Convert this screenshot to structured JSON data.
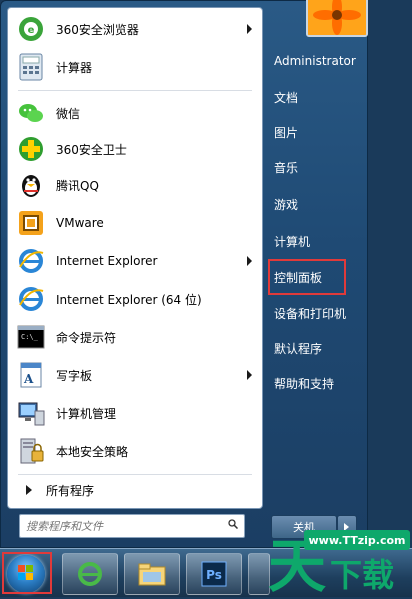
{
  "programs": [
    {
      "label": "360安全浏览器",
      "icon": "360-browser-icon",
      "submenu": true
    },
    {
      "label": "计算器",
      "icon": "calculator-icon",
      "submenu": false
    },
    {
      "label": "微信",
      "icon": "wechat-icon",
      "submenu": false
    },
    {
      "label": "360安全卫士",
      "icon": "360-safeguard-icon",
      "submenu": false
    },
    {
      "label": "腾讯QQ",
      "icon": "qq-penguin-icon",
      "submenu": false
    },
    {
      "label": "VMware",
      "icon": "vmware-icon",
      "submenu": false
    },
    {
      "label": "Internet Explorer",
      "icon": "internet-explorer-icon",
      "submenu": true
    },
    {
      "label": "Internet Explorer (64 位)",
      "icon": "internet-explorer-icon",
      "submenu": false
    },
    {
      "label": "命令提示符",
      "icon": "command-prompt-icon",
      "submenu": false
    },
    {
      "label": "写字板",
      "icon": "wordpad-icon",
      "submenu": true
    },
    {
      "label": "计算机管理",
      "icon": "computer-management-icon",
      "submenu": false
    },
    {
      "label": "本地安全策略",
      "icon": "local-security-policy-icon",
      "submenu": false
    }
  ],
  "all_programs_label": "所有程序",
  "search": {
    "placeholder": "搜索程序和文件"
  },
  "right_items": [
    "Administrator",
    "文档",
    "图片",
    "音乐",
    "游戏",
    "计算机",
    "控制面板",
    "设备和打印机",
    "默认程序",
    "帮助和支持"
  ],
  "highlighted_item": "控制面板",
  "shutdown_label": "关机",
  "taskbar": {
    "start_icon": "windows-orb-icon",
    "pinned": [
      "internet-explorer-icon",
      "file-explorer-icon",
      "photoshop-icon"
    ],
    "photoshop_label": "Ps"
  },
  "watermark": {
    "url": "www.TTzip.com",
    "glyph": "天",
    "text": "下载"
  },
  "colors": {
    "highlight": "#e03a3a",
    "taskbar": "#1e3f5e",
    "watermark": "#0ea86b"
  }
}
